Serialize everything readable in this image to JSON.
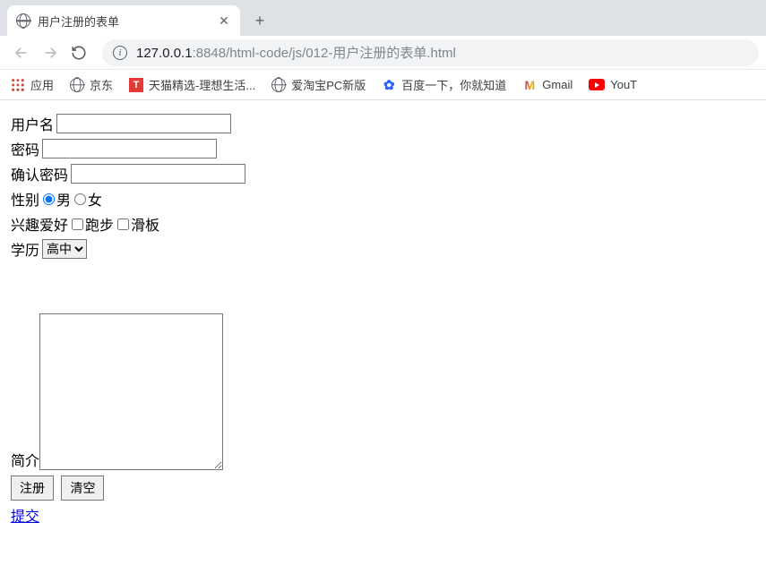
{
  "browser": {
    "tab_title": "用户注册的表单",
    "url_host": "127.0.0.1",
    "url_path": ":8848/html-code/js/012-用户注册的表单.html",
    "bookmarks": {
      "apps": "应用",
      "jd": "京东",
      "tmall": "天猫精选-理想生活...",
      "aitaobao": "爱淘宝PC新版",
      "baidu": "百度一下，你就知道",
      "gmail": "Gmail",
      "youtube": "YouT"
    }
  },
  "form": {
    "username_label": "用户名",
    "password_label": "密码",
    "confirm_label": "确认密码",
    "gender_label": "性别",
    "gender_male": "男",
    "gender_female": "女",
    "hobby_label": "兴趣爱好",
    "hobby_run": "跑步",
    "hobby_skate": "滑板",
    "education_label": "学历",
    "education_selected": "高中",
    "intro_label": "简介",
    "submit_btn": "注册",
    "reset_btn": "清空",
    "submit_link": "提交"
  }
}
